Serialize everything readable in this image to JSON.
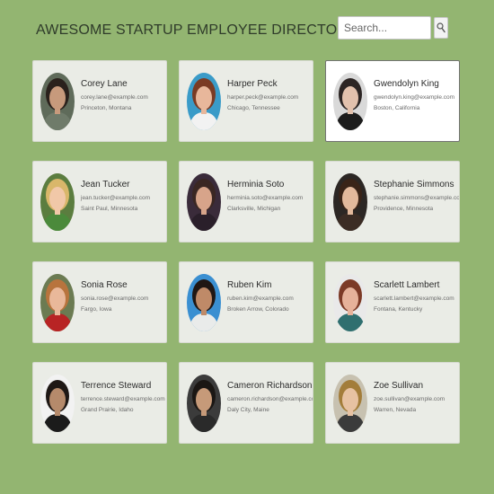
{
  "header": {
    "title": "AWESOME STARTUP EMPLOYEE DIRECTORY"
  },
  "search": {
    "placeholder": "Search...",
    "icon": "search-icon"
  },
  "employees": [
    {
      "name": "Corey Lane",
      "email": "corey.lane@example.com",
      "location": "Princeton, Montana",
      "selected": false,
      "skin": "#c79a7c",
      "hair": "#2a211c",
      "shirt": "#6f7b6a",
      "bg": "#5f6b5a"
    },
    {
      "name": "Harper Peck",
      "email": "harper.peck@example.com",
      "location": "Chicago, Tennessee",
      "selected": false,
      "skin": "#e8b79b",
      "hair": "#7a3b24",
      "shirt": "#f2f2f2",
      "bg": "#3a9bc8"
    },
    {
      "name": "Gwendolyn King",
      "email": "gwendolyn.king@example.com",
      "location": "Boston, California",
      "selected": true,
      "skin": "#e2c1ad",
      "hair": "#2c2524",
      "shirt": "#1c1c1c",
      "bg": "#d9d9d9"
    },
    {
      "name": "Jean Tucker",
      "email": "jean.tucker@example.com",
      "location": "Saint Paul, Minnesota",
      "selected": false,
      "skin": "#f1c8a8",
      "hair": "#d9b76a",
      "shirt": "#4b8a3b",
      "bg": "#5b7d3f"
    },
    {
      "name": "Herminia Soto",
      "email": "herminia.soto@example.com",
      "location": "Clarksville, Michigan",
      "selected": false,
      "skin": "#d7a48a",
      "hair": "#3a2723",
      "shirt": "#2a1f2a",
      "bg": "#3a2b3a"
    },
    {
      "name": "Stephanie Simmons",
      "email": "stephanie.simmons@example.com",
      "location": "Providence, Minnesota",
      "selected": false,
      "skin": "#e3b99c",
      "hair": "#3a2418",
      "shirt": "#3b2c24",
      "bg": "#2c2724"
    },
    {
      "name": "Sonia Rose",
      "email": "sonia.rose@example.com",
      "location": "Fargo, Iowa",
      "selected": false,
      "skin": "#e9b89a",
      "hair": "#b8743d",
      "shirt": "#b82424",
      "bg": "#6b7b52"
    },
    {
      "name": "Ruben Kim",
      "email": "ruben.kim@example.com",
      "location": "Broken Arrow, Colorado",
      "selected": false,
      "skin": "#bf8a68",
      "hair": "#201714",
      "shirt": "#e9ebea",
      "bg": "#3a8fd1"
    },
    {
      "name": "Scarlett Lambert",
      "email": "scarlett.lambert@example.com",
      "location": "Fontana, Kentucky",
      "selected": false,
      "skin": "#e6b29a",
      "hair": "#7c3a26",
      "shirt": "#2f6f6f",
      "bg": "#e9e9e9"
    },
    {
      "name": "Terrence Steward",
      "email": "terrence.steward@example.com",
      "location": "Grand Prairie, Idaho",
      "selected": false,
      "skin": "#b58a6b",
      "hair": "#1e1815",
      "shirt": "#1b1b1b",
      "bg": "#f2f2f2"
    },
    {
      "name": "Cameron Richardson",
      "email": "cameron.richardson@example.com",
      "location": "Daly City, Maine",
      "selected": false,
      "skin": "#c69a79",
      "hair": "#1b1714",
      "shirt": "#2a2a2a",
      "bg": "#3b3b3b"
    },
    {
      "name": "Zoe Sullivan",
      "email": "zoe.sullivan@example.com",
      "location": "Warren, Nevada",
      "selected": false,
      "skin": "#e7c2a2",
      "hair": "#a37d3a",
      "shirt": "#3b3b3b",
      "bg": "#c7c1b0"
    }
  ]
}
